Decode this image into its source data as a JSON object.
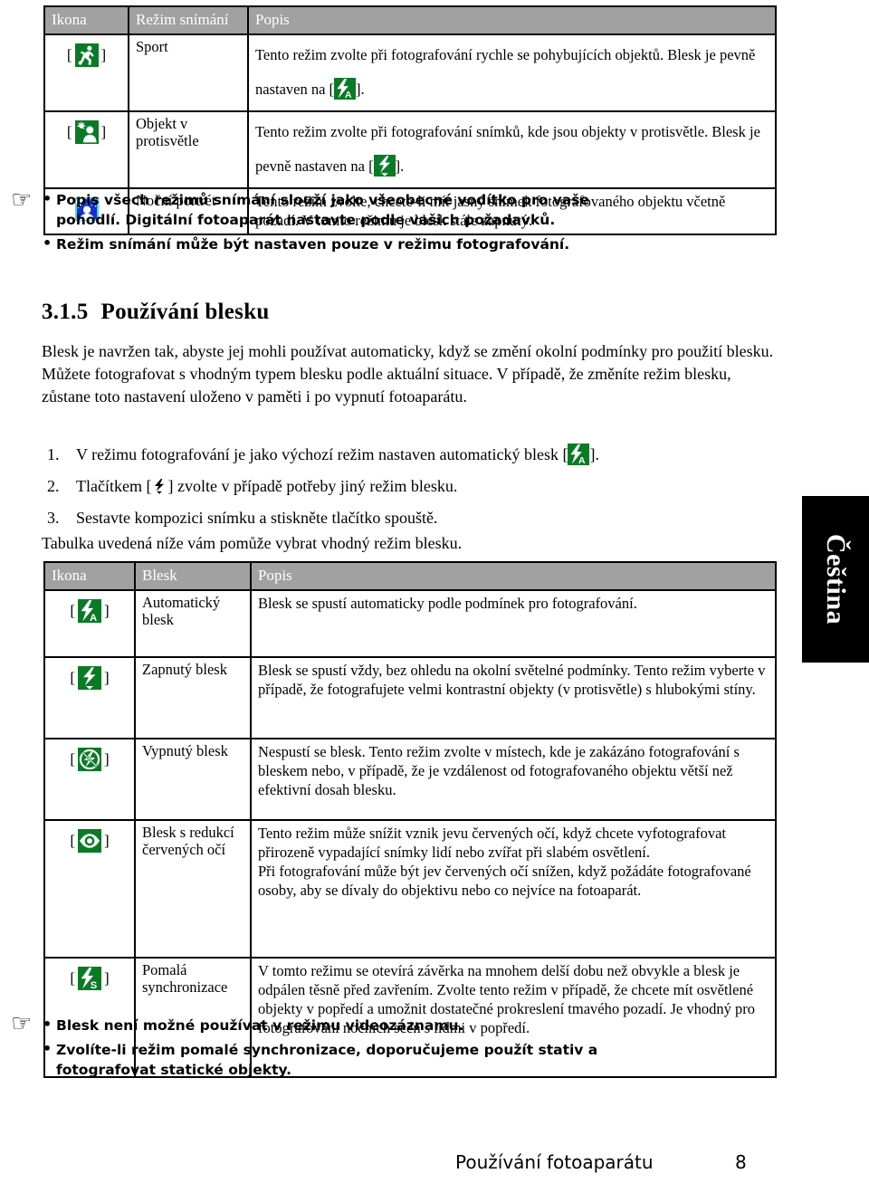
{
  "page": {
    "language_tab": "Čeština",
    "footer_title": "Používání fotoaparátu",
    "footer_page_number": "8",
    "colors": {
      "table_header_bg": "#a1a1a1",
      "icon_green": "#0a7a26",
      "icon_blue": "#1033cc",
      "icon_blue_border": "#45d7f5",
      "text": "#000000",
      "tab_bg": "#000000"
    }
  },
  "scene_mode_table": {
    "headers": [
      "Ikona",
      "Režim snímání",
      "Popis"
    ],
    "rows": [
      {
        "icon": "sport-runner-icon",
        "icon_bracketed": true,
        "icon_color": "green",
        "mode": "Sport",
        "desc_part1": "Tento režim zvolte při fotografování rychle se pohybujících objektů. Blesk je pevně nastaven na [",
        "desc_inline_icon": "flash-auto-icon",
        "desc_part2": "]."
      },
      {
        "icon": "backlight-subject-icon",
        "icon_bracketed": true,
        "icon_color": "green",
        "mode": "Objekt v protisvětle",
        "desc_part1": "Tento režim zvolte při fotografování snímků, kde jsou objekty v protisvětle. Blesk je pevně nastaven na [",
        "desc_inline_icon": "flash-on-icon",
        "desc_part2": "]."
      },
      {
        "icon": "night-portrait-icon",
        "icon_bracketed": false,
        "icon_color": "blue",
        "mode": "Noční portrét",
        "desc_part1": "Tento režim zvolte, chcete-li mít jasný snímek fotografovaného objektu včetně pozadí. V tomto režimu je blesk stále zapnutý.",
        "desc_inline_icon": "",
        "desc_part2": ""
      }
    ]
  },
  "notes_top": {
    "hand_icon": "pointing-hand-icon",
    "items": [
      "Popis všech režimů snímání slouží jako všeobecné vodítko pro vaše pohodlí. Digitální fotoaparát nastavte podle vašich požadavků.",
      "Režim snímání může být nastaven pouze v režimu fotografování."
    ]
  },
  "section": {
    "number": "3.1.5",
    "title": "Používání blesku",
    "intro": "Blesk je navržen tak, abyste jej mohli používat automaticky, když se změní okolní podmínky pro použití blesku. Můžete fotografovat s vhodným typem blesku podle aktuální situace. V případě, že změníte režim blesku, zůstane toto nastavení uloženo v paměti i po vypnutí fotoaparátu.",
    "steps": [
      {
        "marker": "1.",
        "text_part1": "V režimu fotografování je jako výchozí režim nastaven automatický blesk [",
        "inline_icon": "flash-auto-icon",
        "text_part2": "]."
      },
      {
        "marker": "2.",
        "text_part1": "Tlačítkem [",
        "inline_icon": "flash-button-icon",
        "text_part2": "] zvolte v případě potřeby jiný režim blesku."
      },
      {
        "marker": "3.",
        "text_part1": "Sestavte kompozici snímku a stiskněte tlačítko spouště.",
        "inline_icon": "",
        "text_part2": ""
      }
    ],
    "after_steps": "Tabulka uvedená níže vám pomůže vybrat vhodný režim blesku."
  },
  "flash_mode_table": {
    "headers": [
      "Ikona",
      "Blesk",
      "Popis"
    ],
    "rows": [
      {
        "icon": "flash-auto-icon",
        "icon_color": "green",
        "name": "Automatický blesk",
        "desc": "Blesk se spustí automaticky podle podmínek pro fotografování."
      },
      {
        "icon": "flash-on-icon",
        "icon_color": "green",
        "name": "Zapnutý blesk",
        "desc": "Blesk se spustí vždy, bez ohledu na okolní světelné podmínky. Tento režim vyberte v případě, že fotografujete velmi kontrastní objekty (v protisvětle) s hlubokými stíny."
      },
      {
        "icon": "flash-off-icon",
        "icon_color": "green",
        "name": "Vypnutý blesk",
        "desc": "Nespustí se blesk. Tento režim zvolte v místech, kde je zakázáno fotografování s bleskem nebo, v případě, že je vzdálenost od fotografovaného objektu větší než efektivní dosah blesku."
      },
      {
        "icon": "red-eye-reduction-icon",
        "icon_color": "green",
        "name": "Blesk s redukcí červených očí",
        "desc": "Tento režim může snížit vznik jevu červených očí, když chcete vyfotografovat přirozeně vypadající snímky lidí nebo zvířat při slabém osvětlení.\nPři fotografování může být jev červených očí snížen, když požádáte fotografované osoby, aby se dívaly do objektivu nebo co nejvíce na fotoaparát."
      },
      {
        "icon": "flash-slow-sync-icon",
        "icon_color": "green",
        "name": "Pomalá synchronizace",
        "desc": "V tomto režimu se otevírá závěrka na mnohem delší dobu než obvykle a blesk je odpálen těsně před zavřením. Zvolte tento režim v případě, že chcete mít osvětlené objekty v popředí a umožnit dostatečné prokreslení tmavého pozadí. Je vhodný pro fotografování nočních scén s lidmi v popředí."
      }
    ]
  },
  "notes_bottom": {
    "hand_icon": "pointing-hand-icon",
    "items": [
      "Blesk není možné používat v režimu videozáznamu.",
      "Zvolíte-li režim pomalé synchronizace, doporučujeme použít stativ a fotografovat statické objekty."
    ]
  }
}
